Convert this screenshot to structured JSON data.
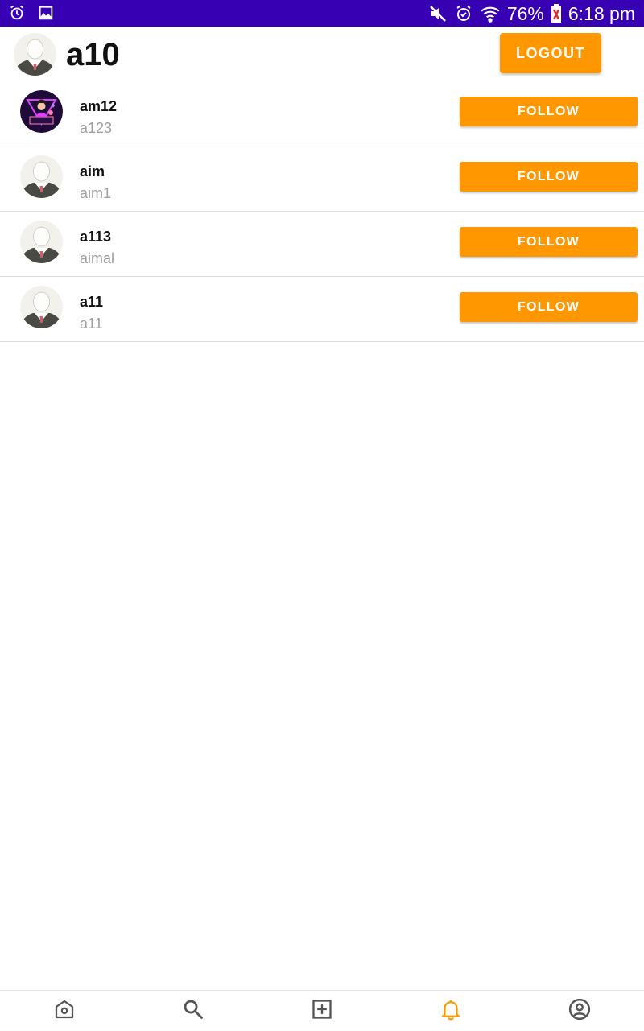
{
  "status_bar": {
    "battery": "76%",
    "time": "6:18 pm",
    "icons": [
      "alarm-icon",
      "image-icon",
      "mute-icon",
      "alarm-icon",
      "wifi-icon",
      "battery-icon"
    ]
  },
  "header": {
    "username": "a10",
    "logout_label": "LOGOUT"
  },
  "users": [
    {
      "name": "am12",
      "handle": "a123",
      "follow_label": "FOLLOW",
      "avatar": "custom"
    },
    {
      "name": "aim",
      "handle": "aim1",
      "follow_label": "FOLLOW",
      "avatar": "default"
    },
    {
      "name": "a113",
      "handle": "aimal",
      "follow_label": "FOLLOW",
      "avatar": "default"
    },
    {
      "name": "a11",
      "handle": "a11",
      "follow_label": "FOLLOW",
      "avatar": "default"
    }
  ],
  "bottom_nav": {
    "items": [
      "home-icon",
      "search-icon",
      "add-post-icon",
      "notifications-icon",
      "profile-icon"
    ],
    "active": "notifications-icon"
  },
  "colors": {
    "status_bar": "#3700b3",
    "accent": "#ff9800",
    "secondary_text": "#9e9e9e",
    "nav_icon": "#555555"
  }
}
